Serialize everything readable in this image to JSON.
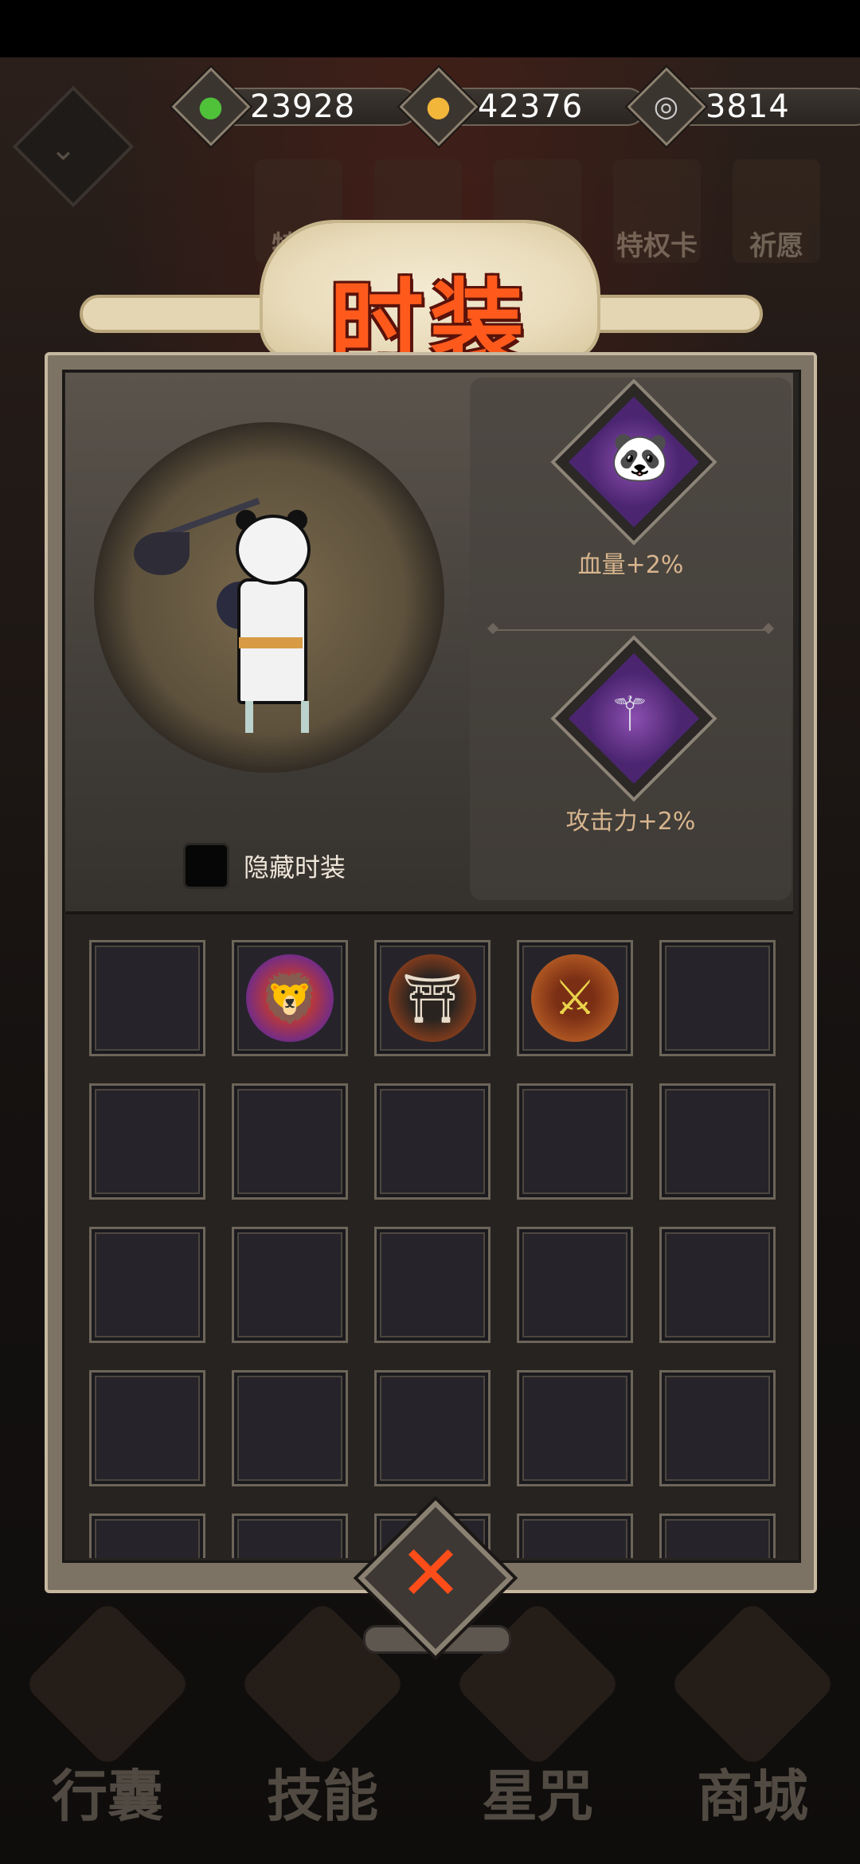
{
  "currency": [
    {
      "icon": "green-gem-icon",
      "value": "23928"
    },
    {
      "icon": "gold-coin-icon",
      "value": "42376"
    },
    {
      "icon": "silver-spiral-icon",
      "value": "3814"
    }
  ],
  "top_menu": [
    "特惠",
    "",
    "",
    "特权卡",
    "祈愿"
  ],
  "title": "时装",
  "bonuses": [
    {
      "icon": "panda-head-icon",
      "label": "血量+2%"
    },
    {
      "icon": "scythe-icon",
      "label": "攻击力+2%"
    }
  ],
  "hide_costume_label": "隐藏时装",
  "grid_slots": [
    "",
    "lion-dance-costume",
    "samurai-costume",
    "spear-costume",
    "",
    "",
    "",
    "",
    "",
    "",
    "",
    "",
    "",
    "",
    "",
    "",
    "",
    "",
    "",
    "",
    "",
    "",
    "",
    "",
    ""
  ],
  "bottom_nav": [
    "行囊",
    "技能",
    "星咒",
    "商城"
  ],
  "colors": {
    "title": "#ff5a1c",
    "bonus_text": "#d7b58e",
    "close_x": "#ff4d1a"
  }
}
